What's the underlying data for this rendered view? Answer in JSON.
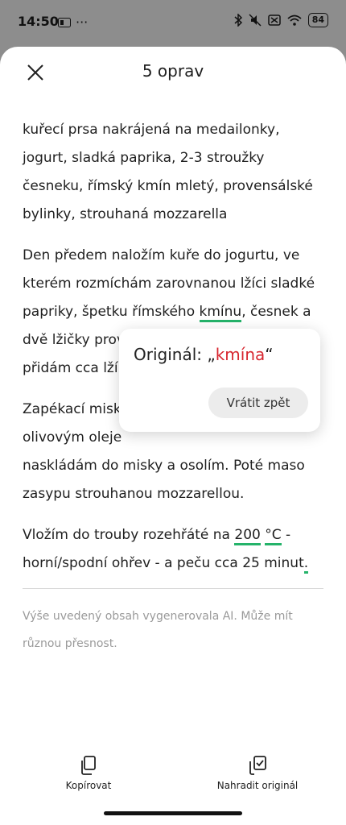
{
  "status": {
    "time": "14:50",
    "battery": "84"
  },
  "header": {
    "title": "5 oprav"
  },
  "content": {
    "p1": "kuřecí prsa nakrájená na medailonky, jogurt, sladká paprika, 2-3 stroužky česneku, římský kmín mletý, provensálské bylinky, strouhaná mozzarella",
    "p2": {
      "before": "Den předem naložím kuře do jogurtu, ve kterém rozmíchám zarovnanou lžíci sladké papriky, špetku římského ",
      "marked": "kmínu",
      "after": ", česnek a dvě lžičky prov",
      "line2": "přidám cca lží"
    },
    "p3": {
      "line1": "Zapékací misk",
      "line2": "olivovým oleje",
      "rest": "naskládám do misky a osolím. Poté maso zasypu strouhanou mozzarellou."
    },
    "p4": {
      "before": "Vložím do trouby rozehřáté na ",
      "mark1": "200",
      "space": " ",
      "mark2": "°C",
      "after": " - horní/spodní ohřev - a peču cca 25 minut",
      "dot": "."
    }
  },
  "disclaimer": "Výše uvedený obsah vygenerovala AI. Může mít různou přesnost.",
  "popup": {
    "label_prefix": "Originál: „",
    "original": "kmína",
    "label_suffix": "“",
    "undo": "Vrátit zpět"
  },
  "actions": {
    "copy": "Kopírovat",
    "replace": "Nahradit originál"
  }
}
